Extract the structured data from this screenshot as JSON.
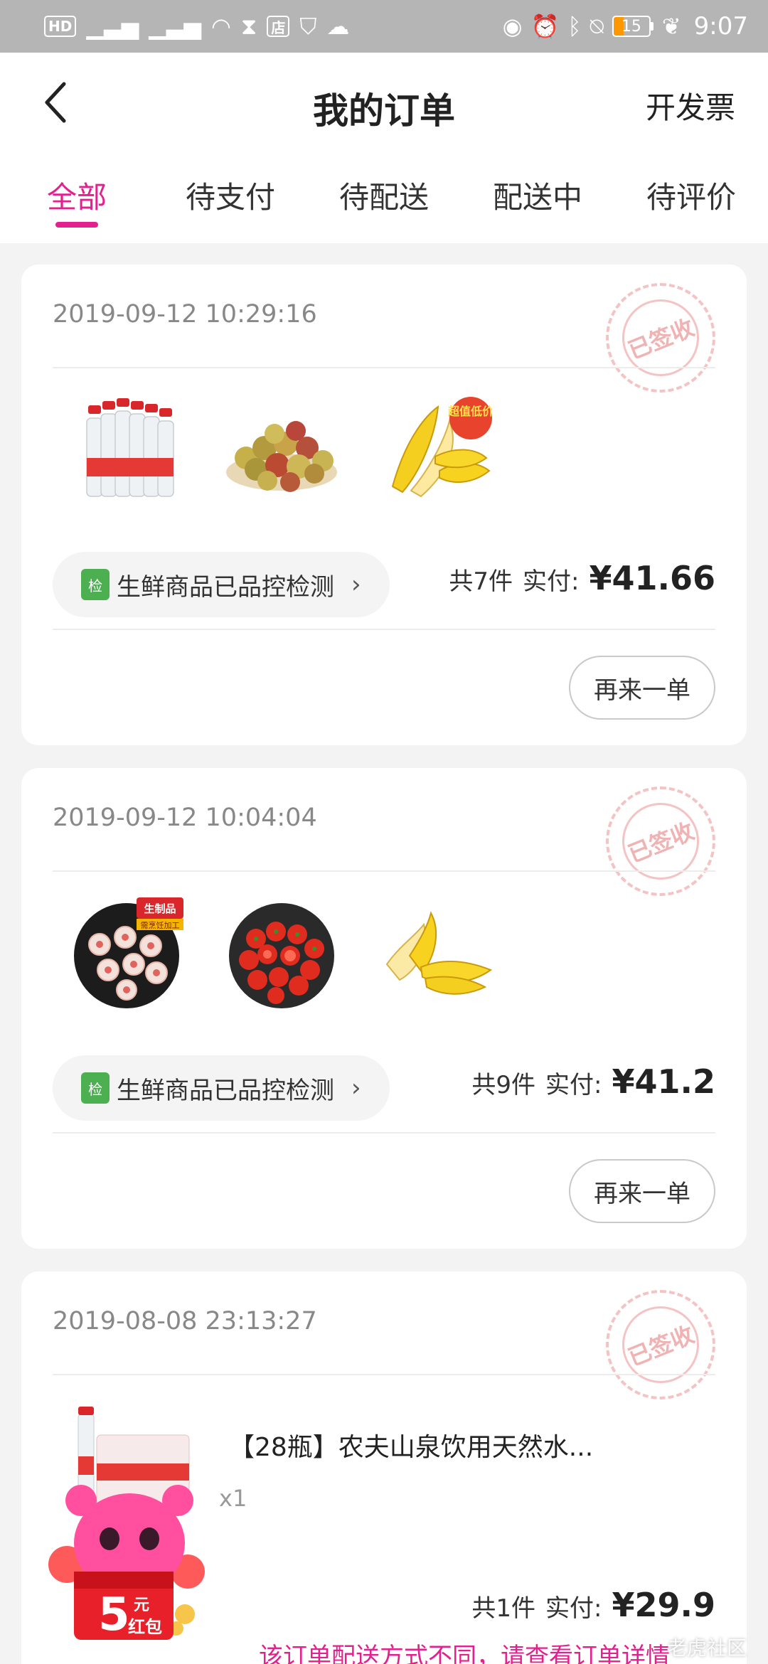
{
  "status_bar": {
    "left_chips": [
      "HD",
      "4G",
      "4G"
    ],
    "battery": "15",
    "time": "9:07"
  },
  "header": {
    "title": "我的订单",
    "invoice_label": "开发票"
  },
  "tabs": [
    {
      "label": "全部",
      "active": true
    },
    {
      "label": "待支付",
      "active": false
    },
    {
      "label": "待配送",
      "active": false
    },
    {
      "label": "配送中",
      "active": false
    },
    {
      "label": "待评价",
      "active": false
    }
  ],
  "orders": [
    {
      "time": "2019-09-12 10:29:16",
      "stamp": "已签收",
      "products": [
        "water-bottles-image",
        "jujube-image",
        "banana-image"
      ],
      "promo_badge": "超值低价",
      "inspect_label": "生鲜商品已品控检测",
      "inspect_icon_text": "检",
      "count_label": "共7件",
      "paid_label": "实付:",
      "amount": "¥41.66",
      "reorder_label": "再来一单"
    },
    {
      "time": "2019-09-12 10:04:04",
      "stamp": "已签收",
      "products": [
        "meatball-image",
        "tomato-image",
        "banana-image"
      ],
      "promo_badge": "生制品",
      "promo_sub": "需烹饪加工",
      "inspect_label": "生鲜商品已品控检测",
      "inspect_icon_text": "检",
      "count_label": "共9件",
      "paid_label": "实付:",
      "amount": "¥41.2",
      "reorder_label": "再来一单"
    },
    {
      "time": "2019-08-08 23:13:27",
      "stamp": "已签收",
      "product_name": "【28瓶】农夫山泉饮用天然水...",
      "qty": "x1",
      "count_label": "共1件",
      "paid_label": "实付:",
      "amount": "¥29.9",
      "notice": "该订单配送方式不同，请查看订单详情"
    }
  ],
  "red_packet": {
    "amount": "5",
    "unit": "元",
    "label": "红包"
  },
  "watermark": "老虎社区"
}
